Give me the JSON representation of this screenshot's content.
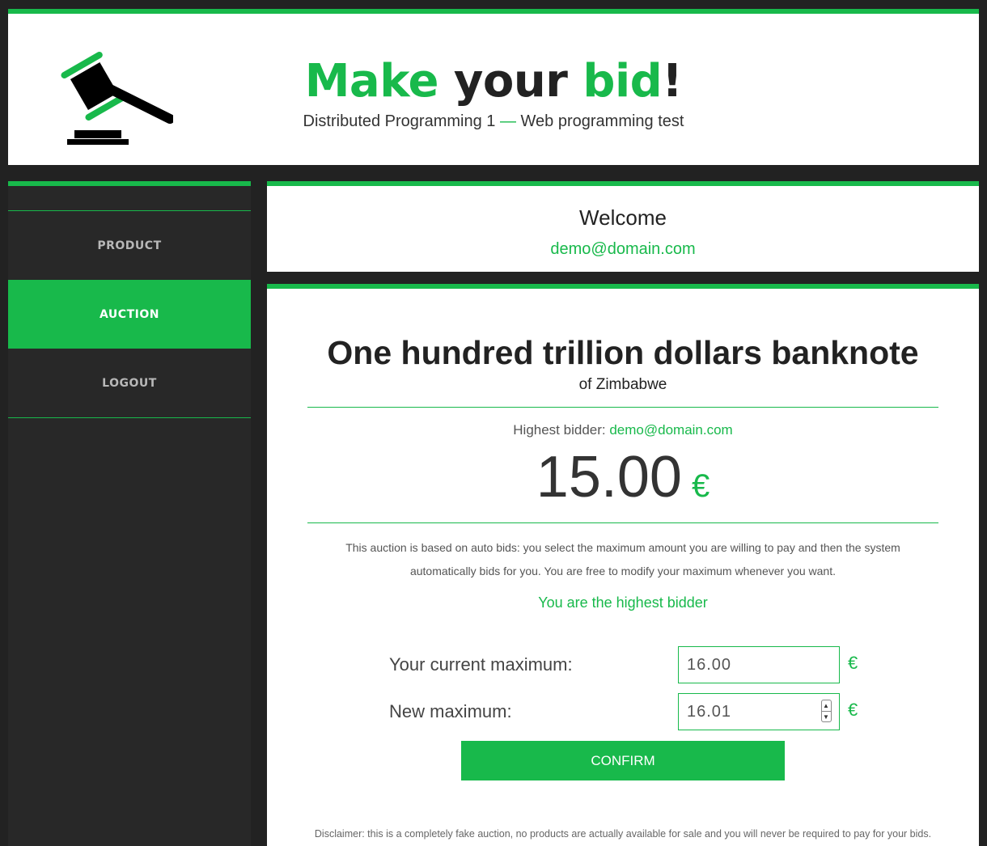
{
  "header": {
    "title_part1": "Make",
    "title_part2": "your",
    "title_part3": "bid",
    "title_part4": "!",
    "subtitle_part1": "Distributed Programming 1",
    "subtitle_separator": "—",
    "subtitle_part2": "Web programming test",
    "logo_icon": "gavel-icon"
  },
  "sidebar": {
    "items": [
      {
        "label": "PRODUCT",
        "active": false
      },
      {
        "label": "AUCTION",
        "active": true
      },
      {
        "label": "LOGOUT",
        "active": false
      }
    ]
  },
  "welcome": {
    "title": "Welcome",
    "email": "demo@domain.com"
  },
  "auction": {
    "product_title": "One hundred trillion dollars banknote",
    "product_subtitle": "of Zimbabwe",
    "highest_label": "Highest bidder:",
    "highest_email": "demo@domain.com",
    "price": "15.00",
    "currency": "€",
    "description": "This auction is based on auto bids: you select the maximum amount you are willing to pay and then the system automatically bids for you. You are free to modify your maximum whenever you want.",
    "status": "You are the highest bidder",
    "current_max_label": "Your current maximum:",
    "current_max_value": "16.00",
    "new_max_label": "New maximum:",
    "new_max_value": "16.01",
    "confirm_label": "CONFIRM",
    "disclaimer": "Disclaimer: this is a completely fake auction, no products are actually available for sale and you will never be required to pay for your bids."
  },
  "colors": {
    "accent": "#18b94b",
    "background": "#222222",
    "sidebar": "#282828"
  }
}
